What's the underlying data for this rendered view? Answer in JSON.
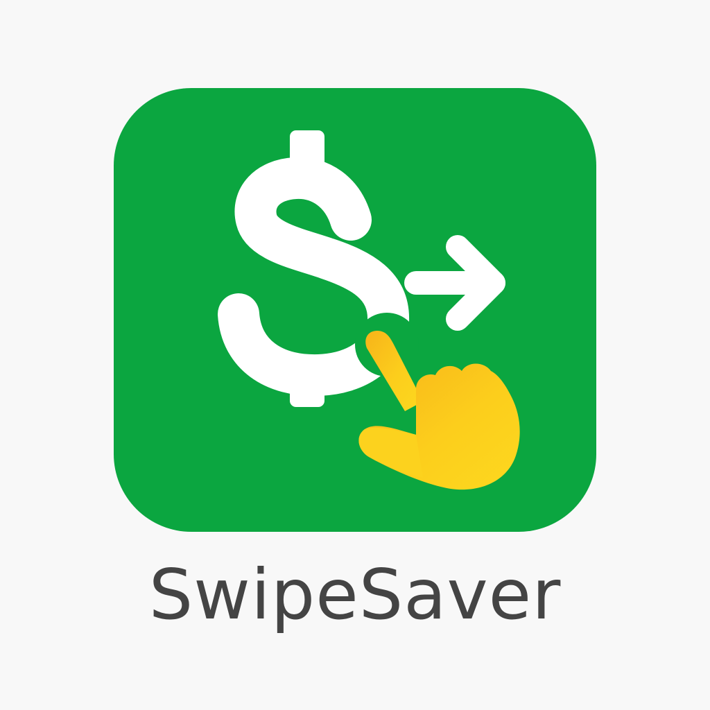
{
  "app": {
    "name": "SwipeSaver"
  },
  "icon": {
    "symbols": [
      "dollar-sign-icon",
      "arrow-right-icon",
      "pointing-hand-icon"
    ]
  },
  "colors": {
    "background": "#f8f8f8",
    "icon_green": "#0ba640",
    "glyph_white": "#ffffff",
    "hand_yellow": "#fcd01c",
    "hand_orange": "#f8b81a",
    "text_gray": "#444444"
  }
}
